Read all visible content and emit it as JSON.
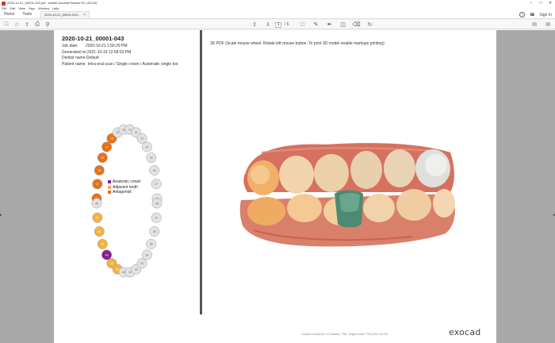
{
  "window": {
    "title": "2020-10-21_00001-043.pdf - Adobe Acrobat Reader DC (32-bit)",
    "controls": [
      "–",
      "□",
      "✕"
    ]
  },
  "menu": [
    "File",
    "Edit",
    "View",
    "Sign",
    "Window",
    "Help"
  ],
  "tabs": {
    "home": "Home",
    "tools": "Tools",
    "document": "2020-10-21_00001-043..."
  },
  "header_right": {
    "help": "?",
    "bell": "🔔",
    "signin": "Sign In"
  },
  "toolbar": {
    "page_current": "1",
    "page_total": "/ 6"
  },
  "report": {
    "title": "2020-10-21_00001-043",
    "job_date_label": "Job date:",
    "job_date_value": "2020-10-21 1:55:29 PM",
    "generated_label": "Generated on:",
    "generated_value": "2021-10-19 12:58:52 PM",
    "dentist_label": "Dentist name:",
    "dentist_value": "Default",
    "patient_label": "Patient name:",
    "patient_value": "Intra-oral scan / Single crown / Automatic single too"
  },
  "viewer_instructions": "3D PDF (Scale    mouse wheel; Rotate    left mouse button. To print 3D model    enable markups printing)",
  "legend": [
    {
      "label": "Anatomic crown",
      "color": "#8b1f8f"
    },
    {
      "label": "Adjacent tooth",
      "color": "#f3a960"
    },
    {
      "label": "Antagonist",
      "color": "#e8711a"
    }
  ],
  "tooth_chart": {
    "upper": [
      {
        "n": "18",
        "state": "antagonist"
      },
      {
        "n": "17",
        "state": "antagonist"
      },
      {
        "n": "16",
        "state": "antagonist"
      },
      {
        "n": "15",
        "state": "antagonist"
      },
      {
        "n": "14",
        "state": "antagonist"
      },
      {
        "n": "13",
        "state": "antagonist"
      },
      {
        "n": "12",
        "state": "none"
      },
      {
        "n": "11",
        "state": "none"
      },
      {
        "n": "21",
        "state": "none"
      },
      {
        "n": "22",
        "state": "none"
      },
      {
        "n": "23",
        "state": "none"
      },
      {
        "n": "24",
        "state": "none"
      },
      {
        "n": "25",
        "state": "none"
      },
      {
        "n": "26",
        "state": "none"
      },
      {
        "n": "27",
        "state": "none"
      },
      {
        "n": "28",
        "state": "none"
      }
    ],
    "lower": [
      {
        "n": "48",
        "state": "none"
      },
      {
        "n": "47",
        "state": "adjacent"
      },
      {
        "n": "46",
        "state": "adjacent"
      },
      {
        "n": "45",
        "state": "adjacent"
      },
      {
        "n": "44",
        "state": "crown"
      },
      {
        "n": "43",
        "state": "adjacent"
      },
      {
        "n": "42",
        "state": "adjacent"
      },
      {
        "n": "41",
        "state": "none"
      },
      {
        "n": "31",
        "state": "none"
      },
      {
        "n": "32",
        "state": "none"
      },
      {
        "n": "33",
        "state": "none"
      },
      {
        "n": "34",
        "state": "none"
      },
      {
        "n": "35",
        "state": "none"
      },
      {
        "n": "36",
        "state": "none"
      },
      {
        "n": "37",
        "state": "none"
      },
      {
        "n": "38",
        "state": "none"
      }
    ]
  },
  "footer": "exocad DentalCAD 3.0 Galway 7758 - Engine build 7758 (2021-03-25)",
  "logo": "exocad"
}
